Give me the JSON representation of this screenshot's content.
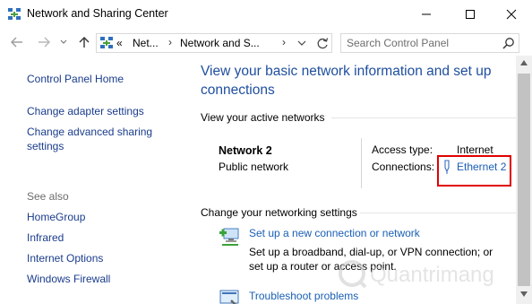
{
  "window": {
    "title": "Network and Sharing Center",
    "icon": "network-center-icon"
  },
  "controls": {
    "minimize": "minimize-icon",
    "maximize": "maximize-icon",
    "close": "close-icon"
  },
  "address": {
    "overflow": "«",
    "crumbs": [
      "Net...",
      "Network and S..."
    ]
  },
  "search": {
    "placeholder": "Search Control Panel"
  },
  "leftnav": {
    "home": "Control Panel Home",
    "adapter": "Change adapter settings",
    "advanced_line1": "Change advanced sharing",
    "advanced_line2": "settings",
    "see_also": "See also",
    "links": [
      "HomeGroup",
      "Infrared",
      "Internet Options",
      "Windows Firewall"
    ]
  },
  "main": {
    "heading_line1": "View your basic network information and set up",
    "heading_line2": "connections",
    "active_networks": "View your active networks",
    "network_name": "Network  2",
    "network_type": "Public network",
    "access_type_label": "Access type:",
    "access_type_value": "Internet",
    "connections_label": "Connections:",
    "connection_link": "Ethernet 2",
    "change_settings": "Change your networking settings",
    "tasks": [
      {
        "link": "Set up a new connection or network",
        "desc_line1": "Set up a broadband, dial-up, or VPN connection; or",
        "desc_line2": "set up a router or access point."
      },
      {
        "link": "Troubleshoot problems"
      }
    ]
  },
  "watermark": {
    "text": "Quantrimang"
  },
  "colors": {
    "link": "#1a5fb4",
    "heading": "#1e4e9e",
    "highlight": "#e00000"
  }
}
